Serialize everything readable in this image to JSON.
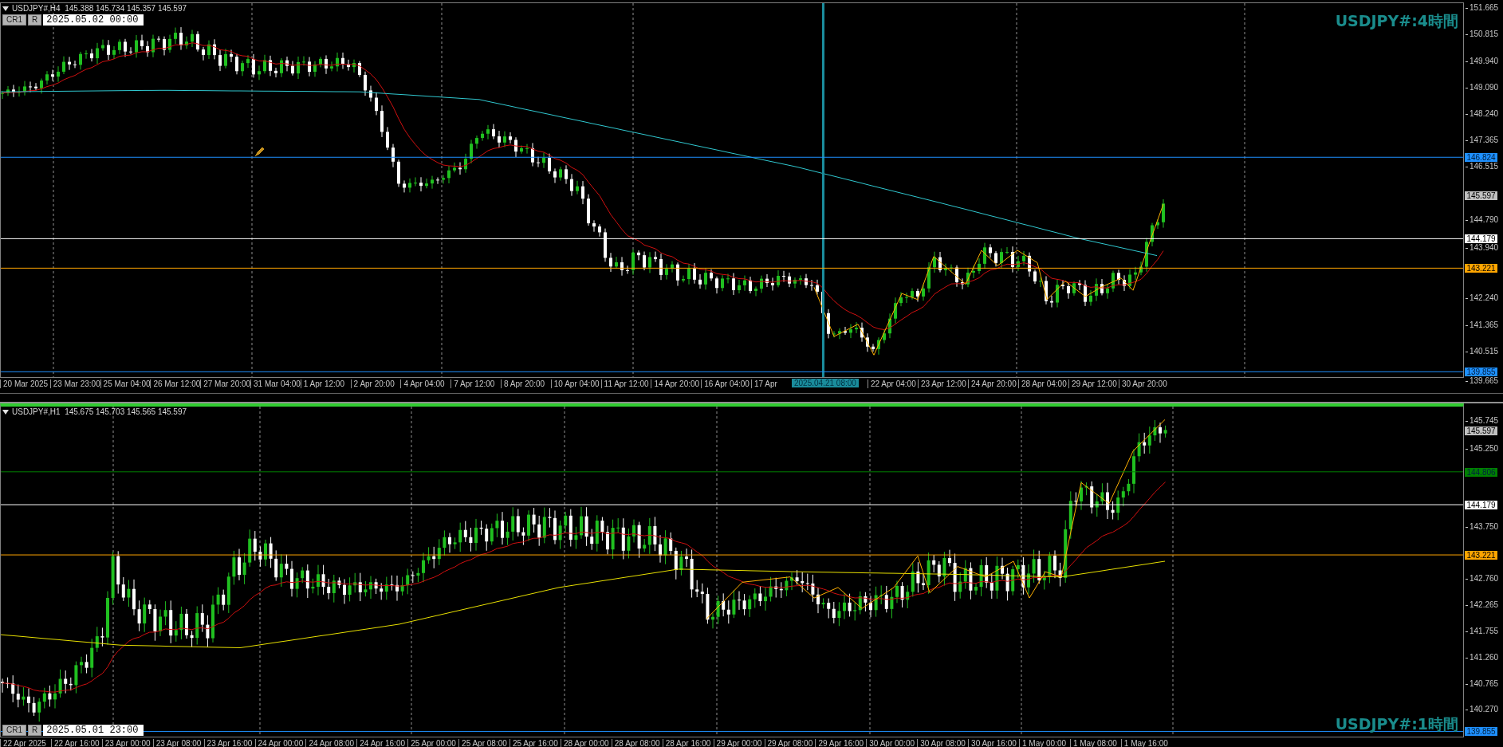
{
  "panels": [
    {
      "header": "USDJPY#,H4  145.388 145.734 145.357 145.597",
      "buttons": [
        "CR1",
        "R"
      ],
      "date_field": "2025.05.02 00:00",
      "watermark": "USDJPY#:4時間",
      "price_ticks": [
        "151.665",
        "150.815",
        "149.940",
        "149.090",
        "148.240",
        "147.365",
        "146.515",
        "144.790",
        "143.940",
        "142.240",
        "141.365",
        "140.515",
        "139.665"
      ],
      "levels": [
        {
          "price": "146.824",
          "kind": "line",
          "color": "#1e90ff"
        },
        {
          "price": "145.597",
          "kind": "bid",
          "color": "#c0c0c0"
        },
        {
          "price": "144.179",
          "kind": "line",
          "color": "#ffffff"
        },
        {
          "price": "143.221",
          "kind": "line",
          "color": "#ffa500"
        },
        {
          "price": "139.855",
          "kind": "line",
          "color": "#1e90ff"
        }
      ],
      "time_labels": [
        "20 Mar 2025",
        "23 Mar 23:00",
        "25 Mar 04:00",
        "26 Mar 12:00",
        "27 Mar 20:00",
        "31 Mar 04:00",
        "1 Apr 12:00",
        "2 Apr 20:00",
        "4 Apr 04:00",
        "7 Apr 12:00",
        "8 Apr 20:00",
        "10 Apr 04:00",
        "11 Apr 12:00",
        "14 Apr 20:00",
        "16 Apr 04:00",
        "17 Apr",
        "22 Apr 04:00",
        "23 Apr 12:00",
        "24 Apr 20:00",
        "28 Apr 04:00",
        "29 Apr 12:00",
        "30 Apr 20:00"
      ],
      "cursor_label": "2025.04.21 08:00"
    },
    {
      "header": "USDJPY#,H1  145.675 145.703 145.565 145.597",
      "buttons": [
        "CR1",
        "R"
      ],
      "date_field": "2025.05.01 23:00",
      "watermark": "USDJPY#:1時間",
      "price_ticks": [
        "145.745",
        "145.250",
        "143.750",
        "142.760",
        "142.265",
        "141.755",
        "141.260",
        "140.765",
        "140.270"
      ],
      "levels": [
        {
          "price": "145.597",
          "kind": "bid",
          "color": "#c0c0c0"
        },
        {
          "price": "144.806",
          "kind": "line",
          "color": "#008000"
        },
        {
          "price": "144.179",
          "kind": "line",
          "color": "#ffffff"
        },
        {
          "price": "143.221",
          "kind": "line",
          "color": "#ffa500"
        },
        {
          "price": "139.855",
          "kind": "line",
          "color": "#1e90ff"
        }
      ],
      "time_labels": [
        "22 Apr 2025",
        "22 Apr 16:00",
        "23 Apr 00:00",
        "23 Apr 08:00",
        "23 Apr 16:00",
        "24 Apr 00:00",
        "24 Apr 08:00",
        "24 Apr 16:00",
        "25 Apr 00:00",
        "25 Apr 08:00",
        "25 Apr 16:00",
        "28 Apr 00:00",
        "28 Apr 08:00",
        "28 Apr 16:00",
        "29 Apr 00:00",
        "29 Apr 08:00",
        "29 Apr 16:00",
        "30 Apr 00:00",
        "30 Apr 08:00",
        "30 Apr 16:00",
        "1 May 00:00",
        "1 May 08:00",
        "1 May 16:00"
      ]
    }
  ]
}
